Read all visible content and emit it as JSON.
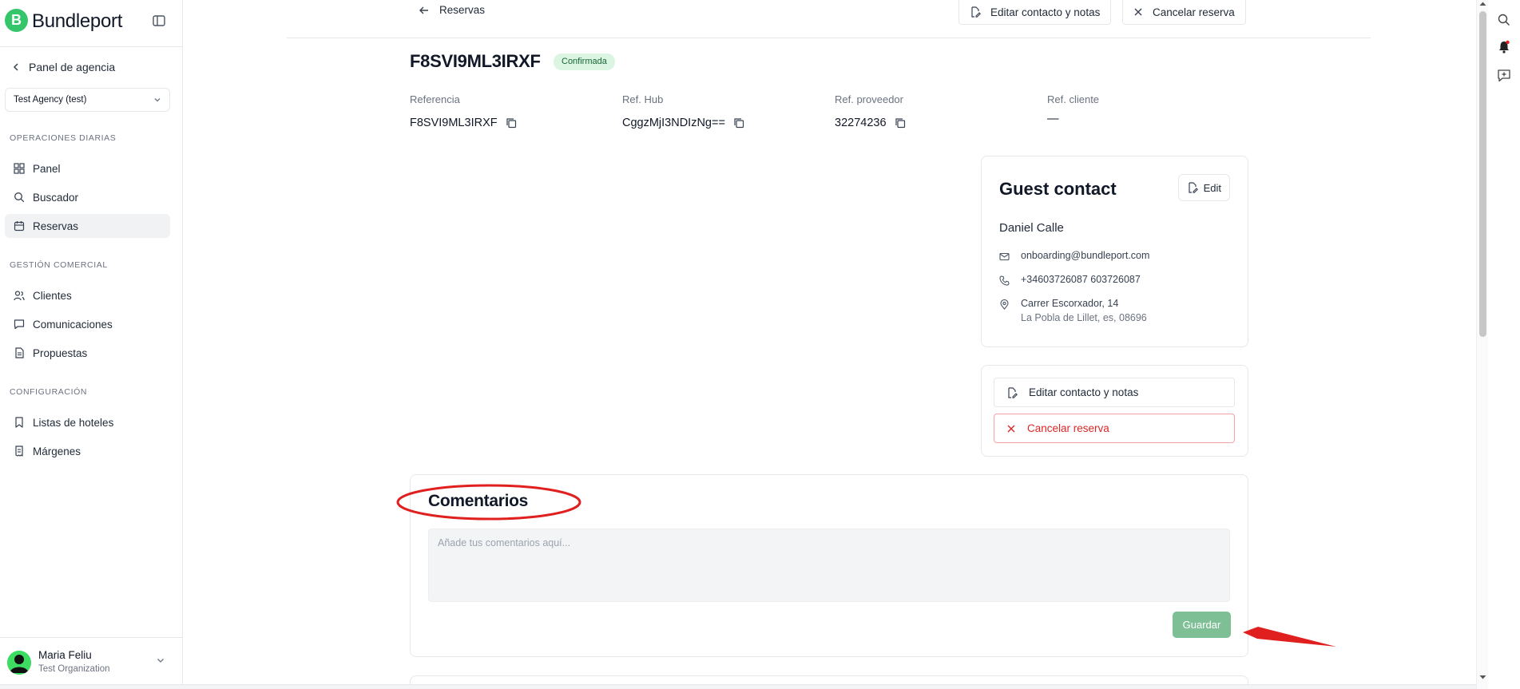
{
  "app": {
    "name": "Bundleport"
  },
  "sidebar": {
    "back_label": "Panel de agencia",
    "agency_select": "Test Agency (test)",
    "sections": {
      "daily": "OPERACIONES DIARIAS",
      "commercial": "GESTIÓN COMERCIAL",
      "config": "CONFIGURACIÓN"
    },
    "items": {
      "panel": "Panel",
      "buscador": "Buscador",
      "reservas": "Reservas",
      "clientes": "Clientes",
      "comunicaciones": "Comunicaciones",
      "propuestas": "Propuestas",
      "listas_hoteles": "Listas de hoteles",
      "margenes": "Márgenes"
    },
    "user": {
      "name": "Maria Feliu",
      "org": "Test Organization"
    }
  },
  "topbar": {
    "breadcrumb": "Reservas",
    "edit_label": "Editar contacto y notas",
    "cancel_label": "Cancelar reserva"
  },
  "booking": {
    "id": "F8SVI9ML3IRXF",
    "status": "Confirmada",
    "refs": {
      "referencia_label": "Referencia",
      "referencia_value": "F8SVI9ML3IRXF",
      "hub_label": "Ref. Hub",
      "hub_value": "CggzMjI3NDIzNg==",
      "proveedor_label": "Ref. proveedor",
      "proveedor_value": "32274236",
      "cliente_label": "Ref. cliente",
      "cliente_value": "—"
    }
  },
  "guest_contact": {
    "title": "Guest contact",
    "edit_label": "Edit",
    "name": "Daniel Calle",
    "email": "onboarding@bundleport.com",
    "phone": "+34603726087 603726087",
    "address_line1": "Carrer Escorxador, 14",
    "address_line2": "La Pobla de Lillet, es, 08696"
  },
  "actions": {
    "edit_label": "Editar contacto y notas",
    "cancel_label": "Cancelar reserva"
  },
  "comments": {
    "title": "Comentarios",
    "placeholder": "Añade tus comentarios aquí...",
    "save_label": "Guardar"
  },
  "colors": {
    "brand": "#35c66b",
    "badge_bg": "#dcf5e3",
    "danger": "#dc2626",
    "save_button": "#7fbf95",
    "annotation": "#e0201f"
  }
}
